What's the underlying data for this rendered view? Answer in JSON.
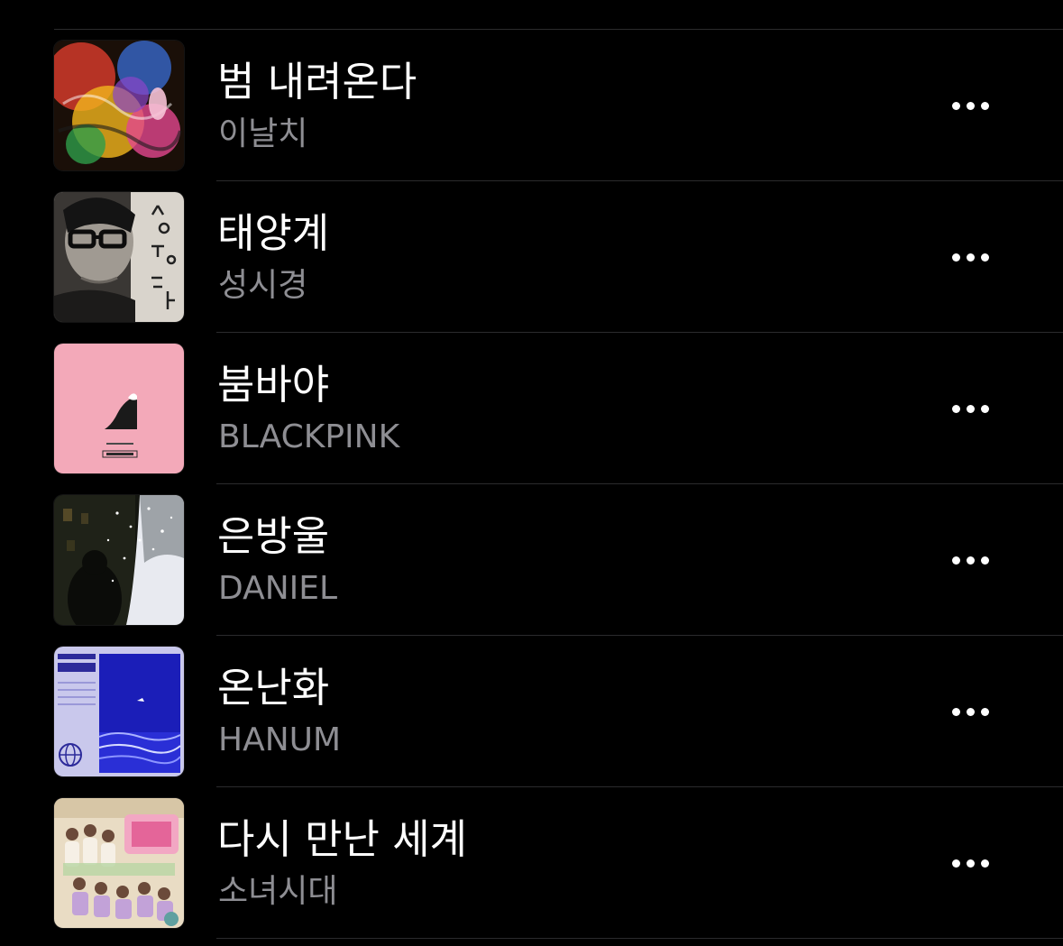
{
  "songs": [
    {
      "title": "범 내려온다",
      "artist": "이날치",
      "artwork": "album-art-colorful-tiger"
    },
    {
      "title": "태양계",
      "artist": "성시경",
      "artwork": "album-art-sung-si-kyung-portrait"
    },
    {
      "title": "붐바야",
      "artist": "BLACKPINK",
      "artwork": "album-art-blackpink-pink"
    },
    {
      "title": "은방울",
      "artist": "DANIEL",
      "artwork": "album-art-snowy-night"
    },
    {
      "title": "온난화",
      "artist": "HANUM",
      "artwork": "album-art-blue-ocean"
    },
    {
      "title": "다시 만난 세계",
      "artist": "소녀시대",
      "artwork": "album-art-snsd-collage"
    }
  ],
  "more_icon": "ellipsis-icon",
  "colors": {
    "background": "#000000",
    "title": "#ffffff",
    "artist": "#8e8e93",
    "divider": "#2b2b2d"
  }
}
